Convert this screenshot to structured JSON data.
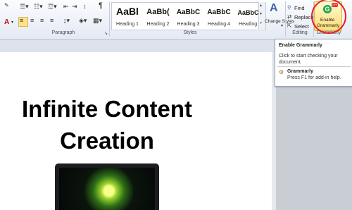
{
  "ribbon": {
    "paragraph_label": "Paragraph",
    "styles_label": "Styles",
    "editing_label": "Editing",
    "grammarly_group_label": "Grammarly",
    "pilcrow": "¶",
    "font_color_glyph": "A",
    "styles": [
      {
        "preview": "AaBl",
        "name": "Heading 1",
        "selected": false
      },
      {
        "preview": "AaBb(",
        "name": "Heading 2",
        "selected": false
      },
      {
        "preview": "AaBbC",
        "name": "Heading 3",
        "selected": false
      },
      {
        "preview": "AaBbC",
        "name": "Heading 4",
        "selected": false
      },
      {
        "preview": "AaBbCc",
        "name": "Heading 5",
        "selected": false
      }
    ],
    "change_styles": "Change Styles",
    "change_styles_arrow": "▾",
    "find_label": "Find",
    "replace_label": "Replace",
    "select_label": "Select",
    "enable_grammarly_line1": "Enable",
    "enable_grammarly_line2": "Grammarly",
    "grammarly_badge": "OFF"
  },
  "tooltip": {
    "title": "Enable Grammarly",
    "description": "Click to start checking your document.",
    "addin_name": "Grammarly",
    "help": "Press F1 for add-in help."
  },
  "document": {
    "title_line1": "Infinite Content",
    "title_line2": "Creation"
  },
  "colors": {
    "accent_red": "#e51d1d",
    "grammarly_green": "#20a64a",
    "selected_fill": "#ffdd74"
  }
}
